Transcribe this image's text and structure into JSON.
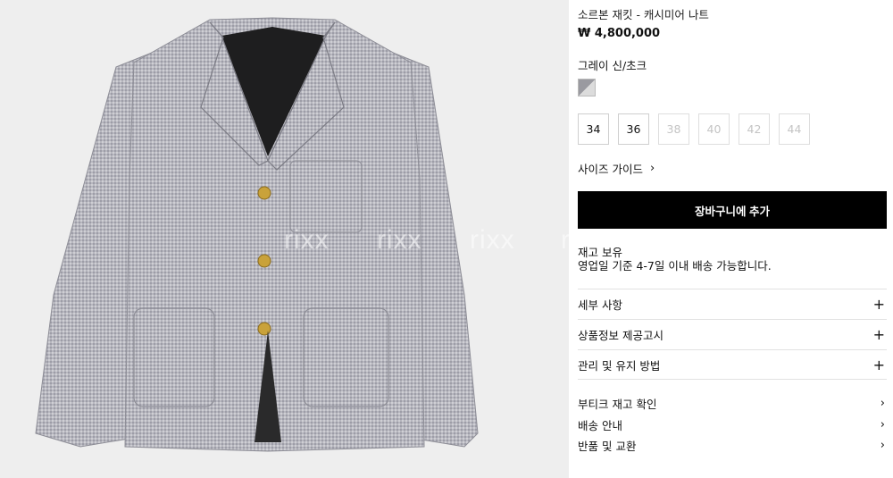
{
  "product": {
    "title": "소르본 재킷 - 캐시미어 나트",
    "price": "₩ 4,800,000",
    "color_name": "그레이 신/초크"
  },
  "watermark": [
    "rixx",
    "rixx",
    "rixx",
    "r"
  ],
  "sizes": [
    {
      "label": "34",
      "available": true
    },
    {
      "label": "36",
      "available": true
    },
    {
      "label": "38",
      "available": false
    },
    {
      "label": "40",
      "available": false
    },
    {
      "label": "42",
      "available": false
    },
    {
      "label": "44",
      "available": false
    }
  ],
  "size_guide": {
    "label": "사이즈 가이드",
    "icon": "chevron-right-icon"
  },
  "cart_button": "장바구니에 추가",
  "stock": {
    "line1": "재고 보유",
    "line2": "영업일 기준 4-7일 이내 배송 가능합니다."
  },
  "accordions": [
    {
      "label": "세부 사항",
      "icon": "+"
    },
    {
      "label": "상품정보 제공고시",
      "icon": "+"
    },
    {
      "label": "관리 및 유지 방법",
      "icon": "+"
    }
  ],
  "links": [
    {
      "label": "부티크 재고 확인",
      "icon": "›"
    },
    {
      "label": "배송 안내",
      "icon": "›"
    },
    {
      "label": "반품 및 교환",
      "icon": "›"
    }
  ],
  "colors": {
    "button_bg": "#000000",
    "image_bg": "#eeeeee",
    "jacket": "#b3b3bb"
  }
}
